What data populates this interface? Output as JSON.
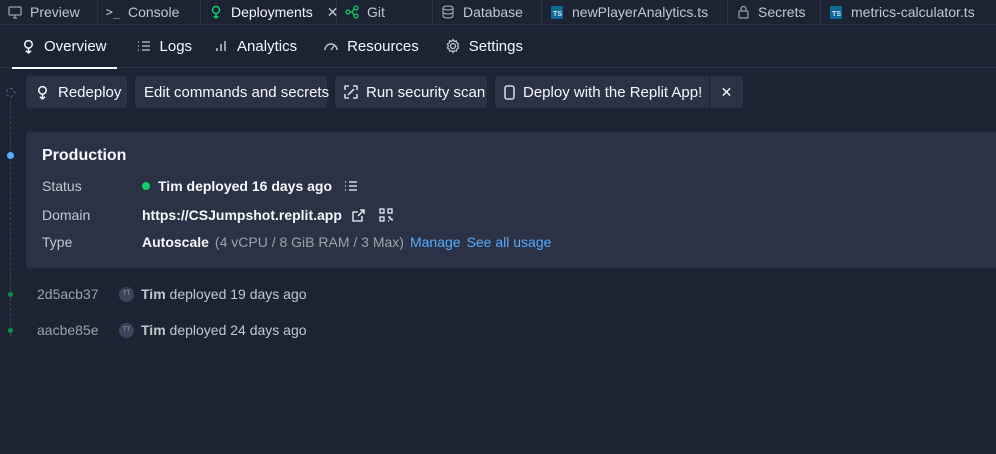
{
  "tabs": [
    {
      "label": "Preview",
      "icon": "monitor-icon"
    },
    {
      "label": "Console",
      "icon": "terminal-icon"
    },
    {
      "label": "Deployments",
      "icon": "deployments-icon",
      "active": true
    },
    {
      "label": "Git",
      "icon": "git-icon"
    },
    {
      "label": "Database",
      "icon": "database-icon"
    },
    {
      "label": "newPlayerAnalytics.ts",
      "icon": "typescript-file-icon",
      "badge": "TS"
    },
    {
      "label": "Secrets",
      "icon": "lock-icon"
    },
    {
      "label": "metrics-calculator.ts",
      "icon": "typescript-file-icon",
      "badge": "TS"
    }
  ],
  "subnav": [
    {
      "label": "Overview",
      "icon": "deployments-icon",
      "active": true
    },
    {
      "label": "Logs",
      "icon": "list-icon"
    },
    {
      "label": "Analytics",
      "icon": "bar-chart-icon"
    },
    {
      "label": "Resources",
      "icon": "gauge-icon"
    },
    {
      "label": "Settings",
      "icon": "gear-icon"
    }
  ],
  "actions": {
    "redeploy": "Redeploy",
    "edit": "Edit commands and secrets",
    "scan": "Run security scan",
    "app": "Deploy with the Replit App!"
  },
  "production": {
    "title": "Production",
    "status_label": "Status",
    "status_value": "Tim deployed 16 days ago",
    "status_color": "#0cce6b",
    "domain_label": "Domain",
    "domain_value": "https://CSJumpshot.replit.app",
    "type_label": "Type",
    "type_value": "Autoscale",
    "type_detail": "(4 vCPU / 8 GiB RAM / 3 Max)",
    "manage_link": "Manage",
    "usage_link": "See all usage"
  },
  "history": [
    {
      "hash": "2d5acb37",
      "user": "Tim",
      "text": "deployed 19 days ago"
    },
    {
      "hash": "aacbe85e",
      "user": "Tim",
      "text": "deployed 24 days ago"
    }
  ],
  "colors": {
    "background": "#1c2333",
    "surface": "#2b3245",
    "accent_link": "#57abff",
    "active_dot": "#57abff",
    "history_dot": "#0a8f4a"
  }
}
